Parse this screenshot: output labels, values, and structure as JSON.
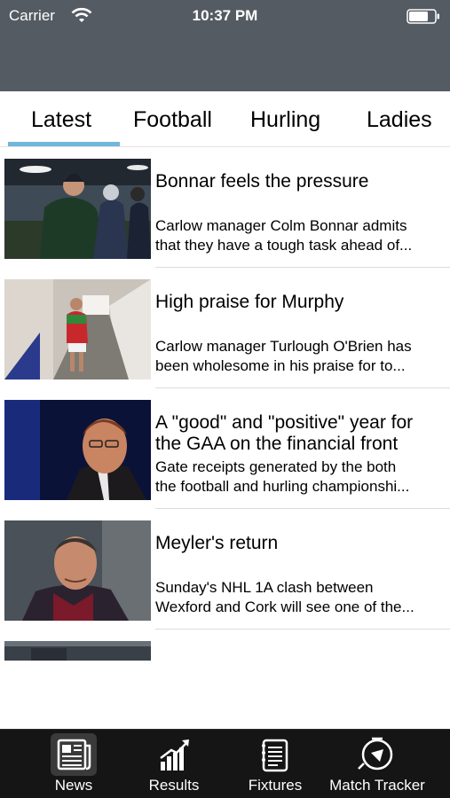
{
  "status_bar": {
    "carrier": "Carrier",
    "time": "10:37 PM"
  },
  "tabs": [
    {
      "label": "Latest",
      "selected": true
    },
    {
      "label": "Football",
      "selected": false
    },
    {
      "label": "Hurling",
      "selected": false
    },
    {
      "label": "Ladies",
      "selected": false
    }
  ],
  "news": [
    {
      "title_lines": [
        "Bonnar feels the pressure"
      ],
      "summary_lines": [
        "Carlow manager Colm Bonnar admits",
        "that they have a tough task ahead of..."
      ],
      "image": "manager-on-sideline-photo"
    },
    {
      "title_lines": [
        "High praise for Murphy"
      ],
      "summary_lines": [
        "Carlow manager Turlough O'Brien has",
        "been wholesome in his praise for to..."
      ],
      "image": "player-in-tunnel-photo"
    },
    {
      "title_lines": [
        "A \"good\" and \"positive\" year for",
        "the GAA on the financial front"
      ],
      "summary_lines": [
        "Gate receipts generated by the both",
        "the football and hurling championshi..."
      ],
      "image": "official-speaking-photo"
    },
    {
      "title_lines": [
        "Meyler's return"
      ],
      "summary_lines": [
        "Sunday's NHL 1A clash between",
        "Wexford and Cork will see one of the..."
      ],
      "image": "coach-portrait-photo"
    }
  ],
  "tab_bar": [
    {
      "label": "News",
      "icon": "newspaper-icon",
      "active": true
    },
    {
      "label": "Results",
      "icon": "bar-chart-icon",
      "active": false
    },
    {
      "label": "Fixtures",
      "icon": "notepad-icon",
      "active": false
    },
    {
      "label": "Match Tracker",
      "icon": "whistle-icon",
      "active": false
    }
  ],
  "colors": {
    "header": "#555b63",
    "tab_indicator": "#6fb7dc",
    "tab_bar": "#151515"
  }
}
